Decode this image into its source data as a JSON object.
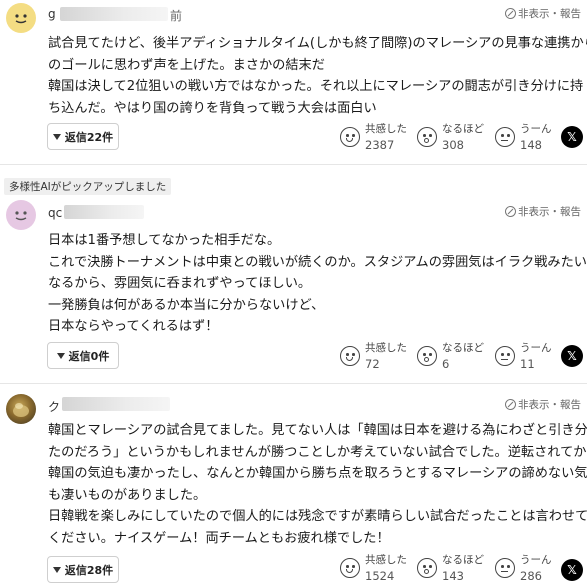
{
  "report_label": "非表示・報告",
  "pickup_label": "多様性AIがピックアップしました",
  "reaction_labels": {
    "empathy": "共感した",
    "insight": "なるほど",
    "hmm": "うーん"
  },
  "share_icon_glyph": "𝕏",
  "comments": [
    {
      "username_visible": "g",
      "username_tail": "前",
      "avatar_color": "#f4dd83",
      "lines": [
        "試合見てたけど、後半アディショナルタイム(しかも終了間際)のマレーシアの見事な連携から",
        "のゴールに思わず声を上げた。まさかの結末だ",
        "韓国は決して2位狙いの戦い方ではなかった。それ以上にマレーシアの闘志が引き分けに持",
        "ち込んだ。やはり国の誇りを背負って戦う大会は面白い"
      ],
      "reply_label": "返信22件",
      "empathy": "2387",
      "insight": "308",
      "hmm": "148"
    },
    {
      "username_visible": "qc",
      "username_tail": "",
      "avatar_color": "#e6c8e3",
      "lines": [
        "日本は1番予想してなかった相手だな。",
        "これで決勝トーナメントは中東との戦いが続くのか。スタジアムの雰囲気はイラク戦みたいに",
        "なるから、雰囲気に呑まれずやってほしい。",
        "一発勝負は何があるか本当に分からないけど、",
        "日本ならやってくれるはず！"
      ],
      "reply_label": "返信0件",
      "empathy": "72",
      "insight": "6",
      "hmm": "11"
    },
    {
      "username_visible": "ク",
      "username_tail": "",
      "avatar_color": "#8a6a2e",
      "lines": [
        "韓国とマレーシアの試合見てました。見てない人は「韓国は日本を避ける為にわざと引き分け",
        "たのだろう」というかもしれませんが勝つことしか考えていない試合でした。逆転されてからの",
        "韓国の気迫も凄かったし、なんとか韓国から勝ち点を取ろうとするマレーシアの諦めない気迫",
        "も凄いものがありました。",
        "日韓戦を楽しみにしていたので個人的には残念ですが素晴らしい試合だったことは言わせて",
        "ください。ナイスゲーム！両チームともお疲れ様でした！"
      ],
      "reply_label": "返信28件",
      "empathy": "1524",
      "insight": "143",
      "hmm": "286"
    }
  ]
}
